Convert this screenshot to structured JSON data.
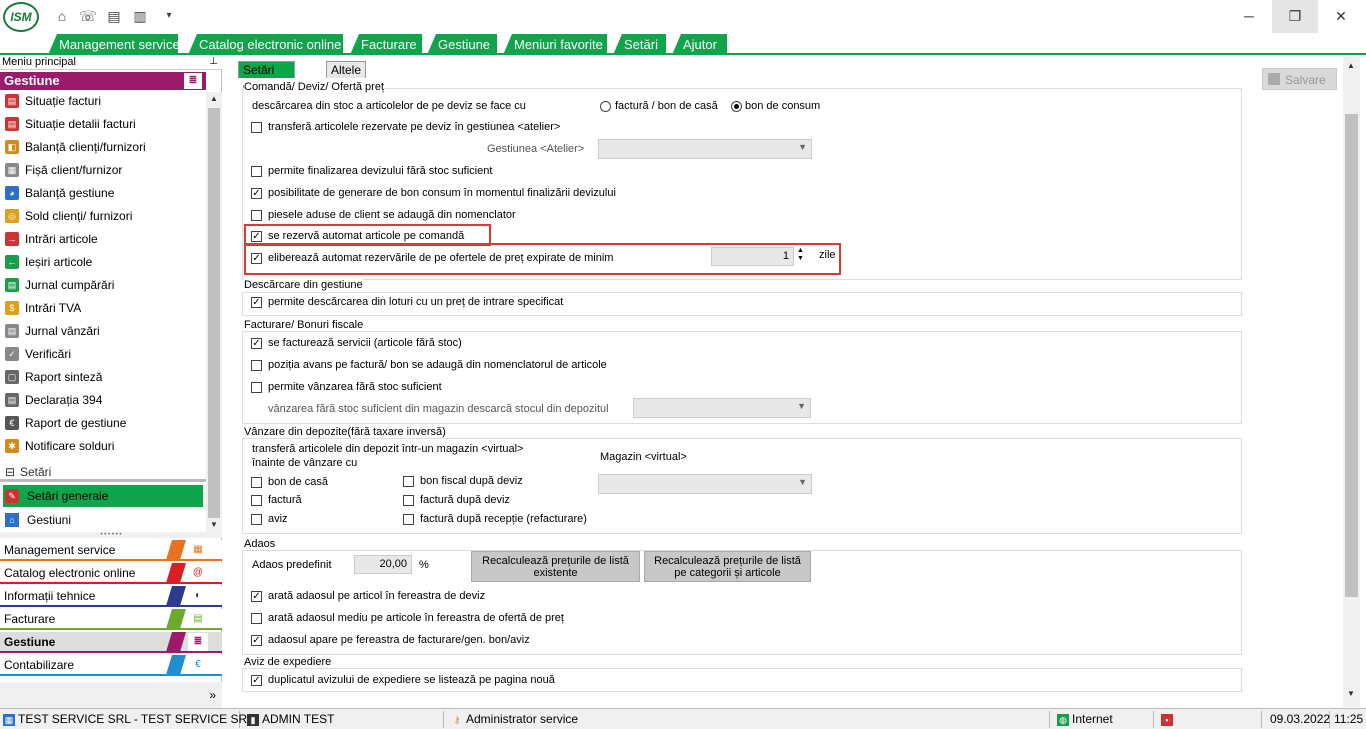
{
  "titlebar": {
    "logo": "ISM",
    "minimize": "─",
    "maximize": "❐",
    "close": "✕"
  },
  "menu_tabs": [
    "Management service",
    "Catalog electronic online",
    "Facturare",
    "Gestiune",
    "Meniuri favorite",
    "Setări",
    "Ajutor"
  ],
  "leftpanel": {
    "header": "Meniu principal",
    "pin": "ᵖ",
    "section": "Gestiune",
    "items": [
      "Situație facturi",
      "Situație detalii facturi",
      "Balanță clienți/furnizori",
      "Fișă client/furnizor",
      "Balanță gestiune",
      "Sold clienți/ furnizori",
      "Intrări articole",
      "Ieșiri articole",
      "Jurnal cumpărări",
      "Intrări TVA",
      "Jurnal vânzări",
      "Verificări",
      "Raport sinteză",
      "Declarația 394",
      "Raport de gestiune",
      "Notificare solduri"
    ],
    "setari_section": "Setări",
    "setari_generale": "Setări generale",
    "gestiuni": "Gestiuni",
    "modules": [
      "Management service",
      "Catalog electronic online",
      "Informații tehnice",
      "Facturare",
      "Gestiune",
      "Contabilizare"
    ],
    "more": "»"
  },
  "colors": {
    "accent_green": "#0ea54b",
    "gestiune_purple": "#9c1a6a",
    "highlight_red": "#d83a3a"
  },
  "page_tabs": [
    "Setări generale",
    "Altele"
  ],
  "save_button": "Salvare",
  "groups": {
    "comanda": {
      "title": "Comandă/ Deviz/ Ofertă preț",
      "descarcare_label": "descărcarea din stoc a articolelor de pe deviz se face cu",
      "radio_factura": "factură / bon de casă",
      "radio_bon": "bon de consum",
      "transfera": "transferă articolele rezervate pe deviz în gestiunea <atelier>",
      "gestiunea_atelier": "Gestiunea <Atelier>",
      "permite_finalizarea": "permite finalizarea devizului fără stoc suficient",
      "posibilitate": "posibilitate de generare de bon consum în momentul finalizării devizului",
      "piesele": "piesele aduse de client se adaugă din nomenclator",
      "rezerva": "se rezervă automat articole pe comandă",
      "elibereaza": "eliberează automat rezervările de pe ofertele de preț expirate de minim",
      "zile_value": "1",
      "zile": "zile"
    },
    "descarcare": {
      "title": "Descărcare din gestiune",
      "permite_loturi": "permite descărcarea din loturi cu un preț de intrare specificat"
    },
    "facturare": {
      "title": "Facturare/ Bonuri fiscale",
      "factureaza": "se facturează servicii (articole fără stoc)",
      "pozitia": "poziția avans pe factură/ bon se adaugă din nomenclatorul de articole",
      "permite_vanzarea": "permite vânzarea fără stoc suficient",
      "vanzarea_label": "vânzarea fără stoc suficient din magazin descarcă stocul din depozitul"
    },
    "vanzare": {
      "title": "Vânzare din depozite(fără taxare inversă)",
      "transfera_line1": "transferă articolele din depozit într-un magazin <virtual>",
      "transfera_line2": "înainte de vânzare cu",
      "magazin": "Magazin <virtual>",
      "bon_casa": "bon de casă",
      "factura": "factură",
      "aviz": "aviz",
      "bon_fiscal": "bon fiscal după deviz",
      "factura_deviz": "factură după deviz",
      "factura_receptie": "factură după recepție (refacturare)"
    },
    "adaos": {
      "title": "Adaos",
      "predefinit": "Adaos predefinit",
      "value": "20,00",
      "pct": "%",
      "btn1_line1": "Recalculează prețurile de listă",
      "btn1_line2": "existente",
      "btn2_line1": "Recalculează prețurile de listă",
      "btn2_line2": "pe categorii și articole",
      "arata_adaos": "arată adaosul pe articol în fereastra de deviz",
      "arata_mediu": "arată adaosul mediu pe articole în fereastra de ofertă de preț",
      "adaosul_apare": "adaosul apare pe fereastra de facturare/gen. bon/aviz"
    },
    "aviz": {
      "title": "Aviz de expediere",
      "duplicatul": "duplicatul avizului de expediere se listează pe pagina nouă"
    }
  },
  "statusbar": {
    "company": "TEST SERVICE SRL - TEST SERVICE SRL",
    "user": "ADMIN TEST",
    "role": "Administrator service",
    "network": "Internet",
    "date": "09.03.2022",
    "time": "11:25"
  }
}
